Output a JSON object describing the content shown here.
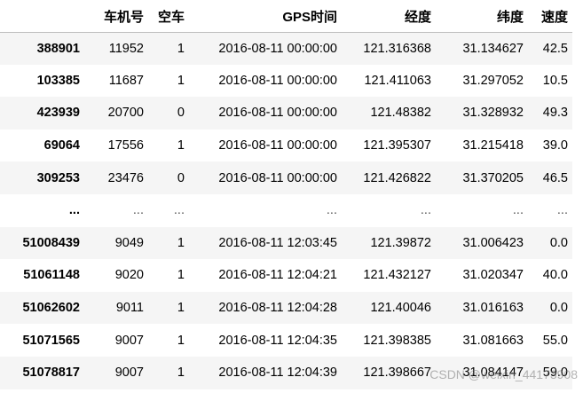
{
  "table": {
    "columns": [
      "",
      "车机号",
      "空车",
      "GPS时间",
      "经度",
      "纬度",
      "速度"
    ],
    "rows": [
      [
        "388901",
        "11952",
        "1",
        "2016-08-11 00:00:00",
        "121.316368",
        "31.134627",
        "42.5"
      ],
      [
        "103385",
        "11687",
        "1",
        "2016-08-11 00:00:00",
        "121.411063",
        "31.297052",
        "10.5"
      ],
      [
        "423939",
        "20700",
        "0",
        "2016-08-11 00:00:00",
        "121.48382",
        "31.328932",
        "49.3"
      ],
      [
        "69064",
        "17556",
        "1",
        "2016-08-11 00:00:00",
        "121.395307",
        "31.215418",
        "39.0"
      ],
      [
        "309253",
        "23476",
        "0",
        "2016-08-11 00:00:00",
        "121.426822",
        "31.370205",
        "46.5"
      ],
      [
        "...",
        "...",
        "...",
        "...",
        "...",
        "...",
        "..."
      ],
      [
        "51008439",
        "9049",
        "1",
        "2016-08-11 12:03:45",
        "121.39872",
        "31.006423",
        "0.0"
      ],
      [
        "51061148",
        "9020",
        "1",
        "2016-08-11 12:04:21",
        "121.432127",
        "31.020347",
        "40.0"
      ],
      [
        "51062602",
        "9011",
        "1",
        "2016-08-11 12:04:28",
        "121.40046",
        "31.016163",
        "0.0"
      ],
      [
        "51071565",
        "9007",
        "1",
        "2016-08-11 12:04:35",
        "121.398385",
        "31.081663",
        "55.0"
      ],
      [
        "51078817",
        "9007",
        "1",
        "2016-08-11 12:04:39",
        "121.398667",
        "31.084147",
        "59.0"
      ]
    ]
  },
  "watermark": "CSDN @weixin_44173908"
}
